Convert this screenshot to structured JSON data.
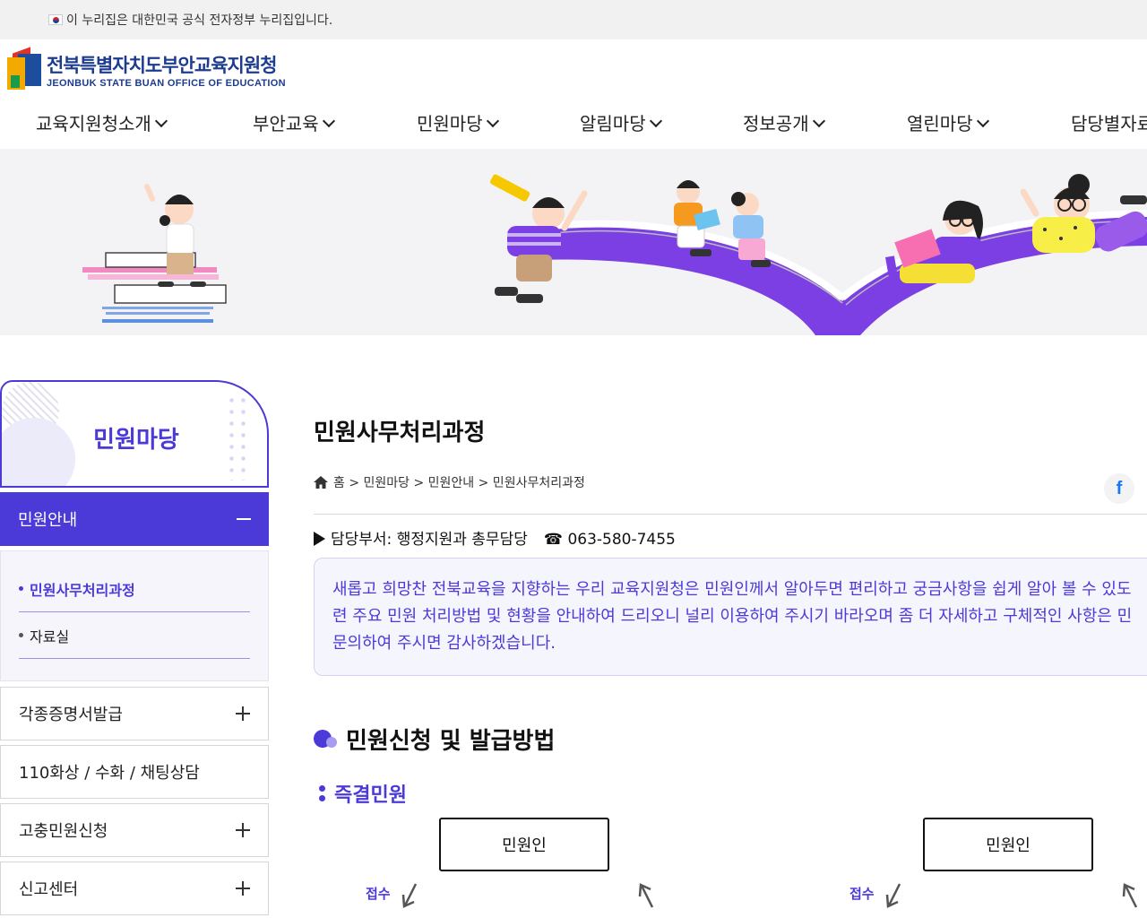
{
  "gov_bar": {
    "text": "이 누리집은 대한민국 공식 전자정부 누리집입니다."
  },
  "logo": {
    "name_ko": "전북특별자치도부안교육지원청",
    "name_en": "JEONBUK STATE BUAN OFFICE OF EDUCATION"
  },
  "gnb": [
    {
      "label": "교육지원청소개"
    },
    {
      "label": "부안교육"
    },
    {
      "label": "민원마당"
    },
    {
      "label": "알림마당"
    },
    {
      "label": "정보공개"
    },
    {
      "label": "열린마당"
    },
    {
      "label": "담당별자료"
    }
  ],
  "lnb": {
    "title": "민원마당",
    "active": "민원안내",
    "sub_items": [
      {
        "label": "민원사무처리과정"
      },
      {
        "label": "자료실"
      }
    ],
    "menus": [
      {
        "label": "각종증명서발급"
      },
      {
        "label": "110화상 / 수화 / 채팅상담"
      },
      {
        "label": "고충민원신청"
      },
      {
        "label": "신고센터"
      }
    ]
  },
  "content": {
    "title": "민원사무처리과정",
    "breadcrumb": "홈 > 민원마당 > 민원안내 > 민원사무처리과정",
    "share_icon": "f",
    "dept": "담당부서: 행정지원과 총무담당",
    "phone": "☎ 063-580-7455",
    "intro_lines": [
      "새롭고 희망찬 전북교육을 지향하는 우리 교육지원청은 민원인께서 알아두면 편리하고 궁금사항을 쉽게 알아 볼 수 있도",
      "련 주요 민원 처리방법 및 현황을 안내하여 드리오니 널리 이용하여 주시기 바라오며 좀 더 자세하고 구체적인 사항은 민",
      "문의하여 주시면 감사하겠습니다."
    ],
    "section_title": "민원신청 및 발급방법",
    "subsection_title": "즉결민원",
    "flow": [
      {
        "box": "민원인",
        "label": "접수"
      },
      {
        "box": "민원인",
        "label": "접수"
      }
    ]
  },
  "colors": {
    "accent": "#4b3ad8",
    "gov_bar": "#f1f1f1",
    "banner": "#f3f2f4"
  }
}
